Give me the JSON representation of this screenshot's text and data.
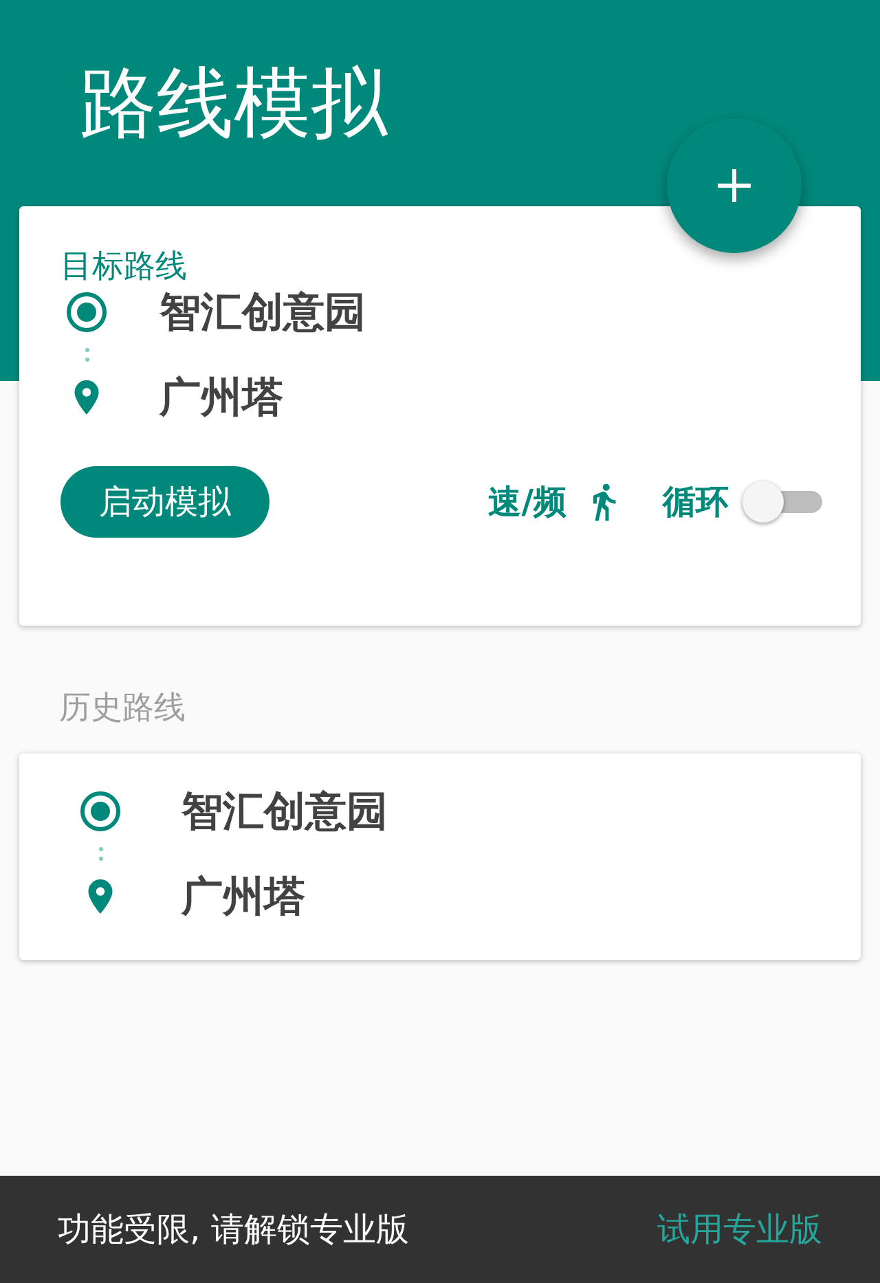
{
  "header": {
    "title": "路线模拟"
  },
  "target_route": {
    "heading": "目标路线",
    "start": "智汇创意园",
    "end": "广州塔",
    "start_button": "启动模拟",
    "speed_label": "速/频",
    "loop_label": "循环",
    "loop_on": false
  },
  "history": {
    "heading": "历史路线",
    "routes": [
      {
        "start": "智汇创意园",
        "end": "广州塔"
      }
    ]
  },
  "snackbar": {
    "message": "功能受限, 请解锁专业版",
    "action": "试用专业版"
  }
}
